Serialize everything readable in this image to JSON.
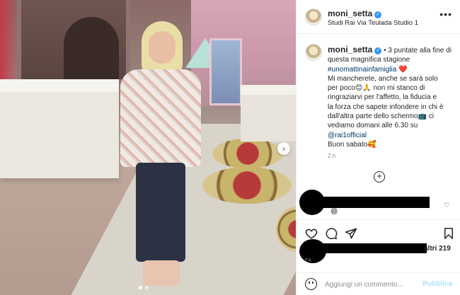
{
  "post": {
    "username": "moni_setta",
    "location": "Studi Rai Via Teulada Studio 1",
    "caption": {
      "username": "moni_setta",
      "lines": [
        {
          "text": " • 3 puntate alla fine di"
        },
        {
          "text": "questa magnifica stagione"
        },
        {
          "link": "#unomattinainfamiglia",
          "suffix": " ❤️"
        },
        {
          "text": "Mi mancherete, anche se sarà solo"
        },
        {
          "text": "per poco😊🙏 non mi stanco di"
        },
        {
          "text": "ringraziarvi per l'affetto, la fiducia e"
        },
        {
          "text": "la forza che sapete infondere in chi è"
        },
        {
          "text": "dall'altra parte dello schermo📺 ci"
        },
        {
          "text": "vediamo domani alle 6.30 su"
        },
        {
          "link": "@rai1official",
          "suffix": ""
        },
        {
          "text": "Buon sabato🥰"
        }
      ]
    },
    "time": "2 h",
    "comment_emoji": "😄",
    "likes_partial": "altri 219",
    "date_partial": "FA"
  },
  "ui": {
    "more_glyph": "•••",
    "verified_glyph": "✓",
    "next_glyph": "›",
    "load_more_glyph": "+",
    "heart_outline_glyph": "♡",
    "comment_placeholder": "Aggiungi un commento...",
    "publish_label": "Pubblica"
  },
  "colors": {
    "link": "#00376b",
    "verified": "#3897f0",
    "publish_disabled": "#b2dffc"
  }
}
